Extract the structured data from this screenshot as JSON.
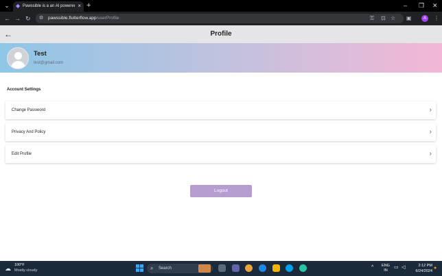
{
  "browser": {
    "tab_title": "Pawssible is a an AI powered P...",
    "tab_close": "×",
    "new_tab": "+",
    "url_host": "pawssible.flutterflow.app",
    "url_path": "/userProfile",
    "profile_initial": "A",
    "window_controls": {
      "minimize": "–",
      "restore": "❐",
      "close": "✕"
    }
  },
  "app": {
    "page_title": "Profile",
    "back_icon": "arrow-left-icon"
  },
  "user": {
    "name": "Test",
    "email": "test@gmail.com"
  },
  "settings": {
    "section_label": "Account Settings",
    "items": [
      {
        "label": "Change Password"
      },
      {
        "label": "Privacy And Policy"
      },
      {
        "label": "Edit Profile"
      }
    ]
  },
  "logout_label": "Logout",
  "taskbar": {
    "weather_temp": "100°F",
    "weather_desc": "Mostly cloudy",
    "search_placeholder": "Search",
    "language": "ENG",
    "region": "IN",
    "time": "2:12 PM",
    "date": "6/24/2024"
  },
  "colors": {
    "banner_start": "#8ec6e6",
    "banner_end": "#f3b7d6",
    "logout_button": "#b59dd0",
    "header_bg": "#e5e5e7"
  }
}
